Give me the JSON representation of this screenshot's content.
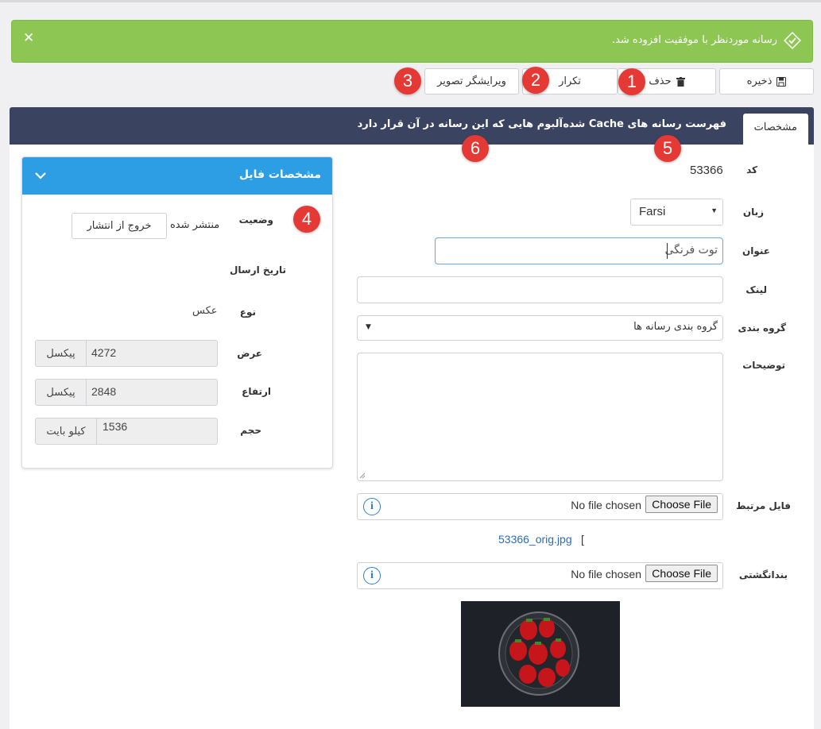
{
  "alert": {
    "message": "رسانه موردنظر با موفقیت افزوده شد.",
    "close_icon": "✕"
  },
  "toolbar": {
    "save_label": "ذخیره",
    "delete_label": "حذف",
    "duplicate_label": "تکرار",
    "image_editor_label": "ویرایشگر تصویر"
  },
  "badges": [
    "1",
    "2",
    "3",
    "4",
    "5",
    "6"
  ],
  "tabs": {
    "properties": "مشخصات",
    "cache_list": "فهرست رسانه های Cache شده",
    "albums": "آلبوم هایی که این رسانه در آن قرار دارد"
  },
  "form": {
    "code_label": "کد",
    "code_value": "53366",
    "language_label": "زبان",
    "language_value": "Farsi",
    "title_label": "عنوان",
    "title_value": "توت فرنگی",
    "link_label": "لینک",
    "link_value": "",
    "category_label": "گروه بندی",
    "category_value": "گروه بندی رسانه ها",
    "description_label": "توضیحات",
    "description_value": "",
    "related_file_label": "فایل مرتبط",
    "file_no_chosen": "No file chosen",
    "file_choose_button": "Choose File",
    "related_file_link": "53366_orig.jpg",
    "related_file_bracket": "[",
    "thumbnail_label": "بندانگشتی"
  },
  "file_card": {
    "title": "مشخصات فایل",
    "status_label": "وضعیت",
    "status_value": "منتشر شده",
    "unpublish_button": "خروج از انتشار",
    "send_date_label": "تاریخ ارسال",
    "type_label": "نوع",
    "type_value": "عکس",
    "width_label": "عرض",
    "width_value": "4272",
    "width_unit": "پیکسل",
    "height_label": "ارتفاع",
    "height_value": "2848",
    "height_unit": "پیکسل",
    "size_label": "حجم",
    "size_value": "1536",
    "size_unit": "کیلو بایت"
  },
  "colors": {
    "alert": "#8dc653",
    "tabbar": "#3a4460",
    "card_header": "#2d9ee3",
    "badge": "#e53935",
    "link": "#2a6db5"
  }
}
